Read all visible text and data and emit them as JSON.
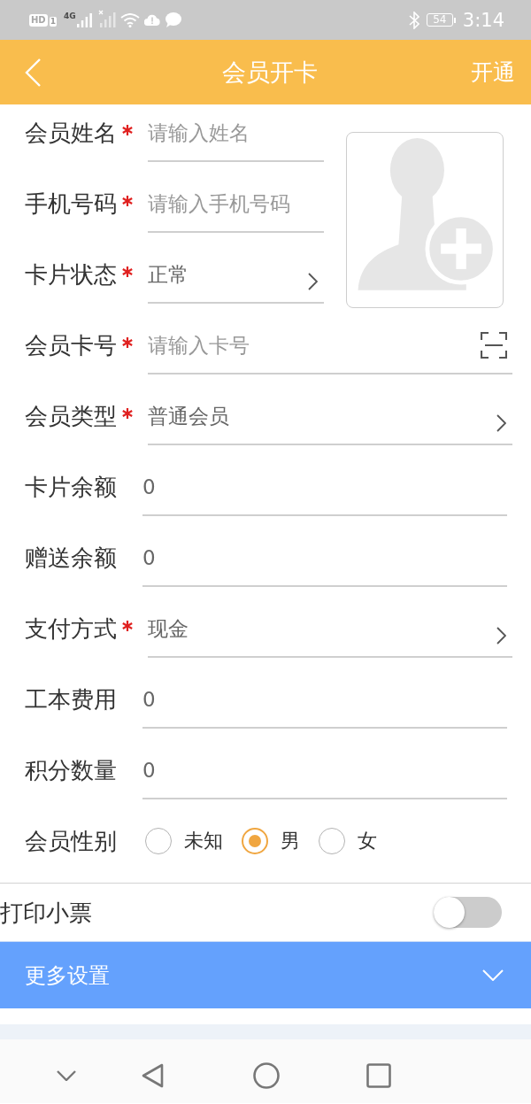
{
  "status_bar": {
    "hd": "HD",
    "sim": "1",
    "network": "4G",
    "battery": "54",
    "time": "3:14"
  },
  "header": {
    "title": "会员开卡",
    "action": "开通"
  },
  "photo_fields": [
    {
      "label": "会员姓名",
      "required": true,
      "kind": "text",
      "placeholder": "请输入姓名"
    },
    {
      "label": "手机号码",
      "required": true,
      "kind": "text",
      "placeholder": "请输入手机号码"
    },
    {
      "label": "卡片状态",
      "required": true,
      "kind": "select",
      "value": "正常"
    }
  ],
  "fields": [
    {
      "label": "会员卡号",
      "required": true,
      "kind": "scan",
      "placeholder": "请输入卡号"
    },
    {
      "label": "会员类型",
      "required": true,
      "kind": "select",
      "value": "普通会员"
    },
    {
      "label": "卡片余额",
      "required": false,
      "kind": "text",
      "value": "0"
    },
    {
      "label": "赠送余额",
      "required": false,
      "kind": "text",
      "value": "0"
    },
    {
      "label": "支付方式",
      "required": true,
      "kind": "select",
      "value": "现金"
    },
    {
      "label": "工本费用",
      "required": false,
      "kind": "text",
      "value": "0"
    },
    {
      "label": "积分数量",
      "required": false,
      "kind": "text",
      "value": "0"
    }
  ],
  "gender": {
    "label": "会员性别",
    "options": [
      {
        "label": "未知",
        "selected": false
      },
      {
        "label": "男",
        "selected": true
      },
      {
        "label": "女",
        "selected": false
      }
    ]
  },
  "print_receipt": {
    "label": "打印小票",
    "on": false
  },
  "more_settings": {
    "label": "更多设置",
    "expanded": false
  }
}
